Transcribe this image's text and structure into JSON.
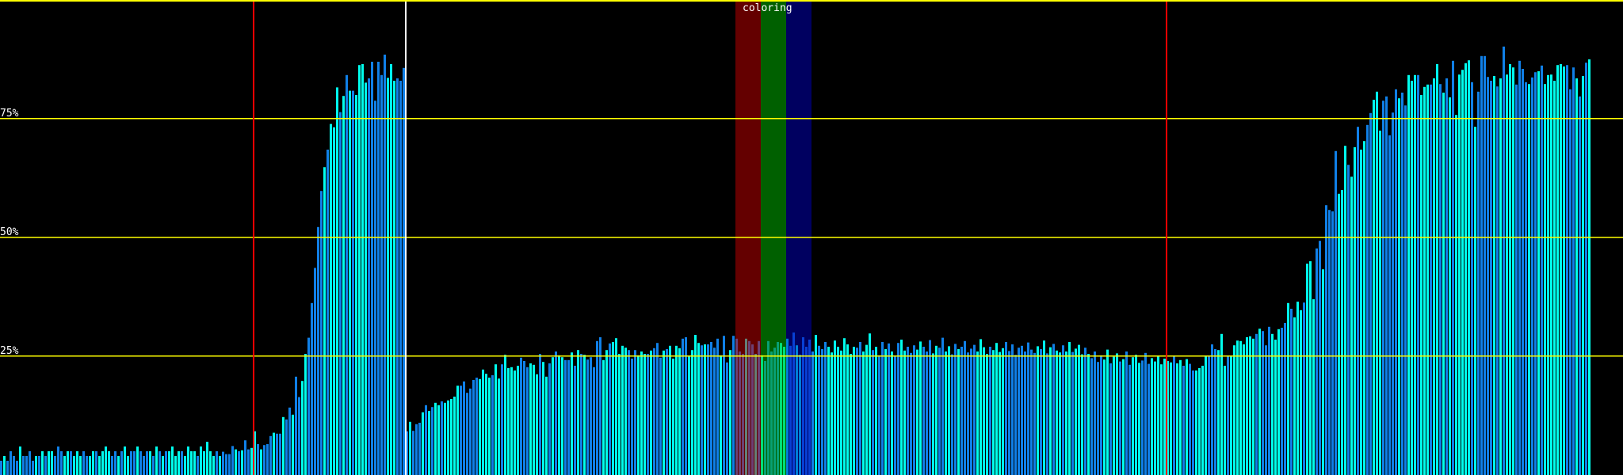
{
  "chart_data": {
    "type": "bar",
    "title": "",
    "xlabel": "",
    "ylabel": "",
    "ylim": [
      0,
      100
    ],
    "y_unit": "%",
    "grid": true,
    "yticks": [
      {
        "value": 75,
        "label": "75%"
      },
      {
        "value": 50,
        "label": "50%"
      },
      {
        "value": 25,
        "label": "25%"
      }
    ],
    "annotation": "coloring",
    "colors": {
      "bar_a": "#00ffee",
      "bar_b": "#1080e8",
      "gridline": "#ffff00",
      "marker_red": "#ff0000",
      "marker_white": "#ffffff",
      "band_red": "#c80000",
      "band_green": "#00c000",
      "band_blue": "#0000c0"
    },
    "values": [
      3,
      4,
      3,
      5,
      4,
      3,
      6,
      4,
      4,
      5,
      3,
      4,
      4,
      5,
      4,
      5,
      5,
      4,
      6,
      5,
      4,
      5,
      5,
      4,
      5,
      4,
      5,
      4,
      4,
      5,
      5,
      4,
      5,
      6,
      5,
      4,
      5,
      4,
      5,
      6,
      4,
      5,
      5,
      6,
      5,
      4,
      5,
      5,
      4,
      6,
      5,
      4,
      5,
      5,
      6,
      4,
      5,
      5,
      4,
      6,
      5,
      5,
      4,
      6,
      5,
      7,
      5,
      4,
      5,
      4,
      4.9,
      4.4,
      4.4,
      6.1,
      5.4,
      5.0,
      5.2,
      7.3,
      5.4,
      5.7,
      9.2,
      6.5,
      5.4,
      6.3,
      6.5,
      8.2,
      8.9,
      8.7,
      8.7,
      12.2,
      11.7,
      14.2,
      12.7,
      20.7,
      16.4,
      19.8,
      25.5,
      28.9,
      36.2,
      43.6,
      52.2,
      59.8,
      64.8,
      68.5,
      73.9,
      73.2,
      81.6,
      76.4,
      79.8,
      84.2,
      80.9,
      80.9,
      80.0,
      86.3,
      86.5,
      82.6,
      83.5,
      87.0,
      78.8,
      87.0,
      84.2,
      88.5,
      83.6,
      86.5,
      83.0,
      83.5,
      83.0,
      85.7,
      9.2,
      11.2,
      9.3,
      10.7,
      11.0,
      13.2,
      14.7,
      13.5,
      14.3,
      15.2,
      14.7,
      15.5,
      15.2,
      15.7,
      16.0,
      16.5,
      18.8,
      18.8,
      19.7,
      17.3,
      18.2,
      20,
      20.5,
      20.2,
      22.2,
      21.3,
      20.5,
      21,
      23.3,
      20.3,
      23.3,
      25.3,
      22.5,
      22.7,
      22,
      23,
      24.7,
      24,
      22.7,
      23.5,
      23.2,
      21.2,
      25.5,
      23.8,
      20.7,
      23.5,
      24.8,
      26,
      25.2,
      24.8,
      24.2,
      24.2,
      25.8,
      23,
      26.3,
      25.5,
      25.3,
      24.3,
      24.8,
      22.7,
      28.2,
      29,
      24.2,
      26.3,
      27.7,
      28,
      28.8,
      25.5,
      27.2,
      26.8,
      26.3,
      24.5,
      26.3,
      25.2,
      26,
      25.5,
      25.5,
      26.2,
      26.7,
      27.8,
      24.7,
      26.2,
      26.5,
      27.2,
      24.5,
      27.2,
      26.7,
      28.7,
      29,
      25,
      26.3,
      29.5,
      27.8,
      27.3,
      27.5,
      27.5,
      28,
      26.8,
      28.7,
      25.2,
      29.3,
      23.7,
      26.3,
      29.3,
      28.7,
      26,
      25.5,
      28.7,
      28.2,
      27.5,
      25.5,
      28.2,
      25.2,
      24,
      28.2,
      26,
      26.8,
      28,
      27.8,
      27,
      28.7,
      27.2,
      30,
      27.3,
      25.3,
      29,
      27,
      28.5,
      26,
      29.5,
      27.2,
      26.5,
      28,
      27,
      25.8,
      28.3,
      27,
      26.2,
      28.8,
      27.5,
      25.5,
      27,
      26.8,
      28,
      26,
      27.4,
      29.8,
      26.3,
      27,
      25.2,
      28,
      26.5,
      27.7,
      26,
      25,
      27.8,
      28.5,
      26.2,
      27,
      25.7,
      27.3,
      26.4,
      28.1,
      27,
      26,
      28.4,
      25.6,
      27.2,
      26.8,
      28.9,
      26,
      27.1,
      25.4,
      27.6,
      26.5,
      27,
      28.2,
      25.8,
      26.6,
      27.4,
      26,
      28.6,
      26.9,
      25.5,
      27,
      26.3,
      27.8,
      25.9,
      26.7,
      28,
      26.1,
      27.5,
      25.3,
      26.8,
      27.2,
      26,
      27.9,
      26.4,
      25.7,
      27.1,
      26.5,
      28.3,
      25.6,
      26.9,
      27.6,
      26.2,
      25.8,
      27.3,
      26,
      28,
      25.9,
      26.6,
      27.4,
      25.4,
      26.8,
      25.5,
      24.6,
      26,
      23.8,
      25.2,
      24.3,
      26.4,
      23.5,
      24.9,
      25.6,
      23.9,
      24.4,
      26,
      23.2,
      24.8,
      25.3,
      23.6,
      24.1,
      25.7,
      23.4,
      24.6,
      23.9,
      25.1,
      23.3,
      24.5,
      24,
      23.7,
      25,
      23.5,
      24.2,
      23,
      24.4,
      23.4,
      22,
      22,
      22.5,
      23,
      25,
      25,
      27.5,
      26.5,
      26.3,
      29.7,
      23,
      25,
      25,
      27.3,
      28.3,
      28.2,
      27.5,
      29,
      29.2,
      28.7,
      29.7,
      30.8,
      30.3,
      27.3,
      31.2,
      29.7,
      28.5,
      30.7,
      31,
      32,
      36.2,
      35,
      33.2,
      36.5,
      34.7,
      36.3,
      44.5,
      45,
      37,
      47.7,
      49.3,
      43.3,
      56.8,
      55.8,
      55.5,
      68.2,
      59.2,
      60,
      69.3,
      65.3,
      62.8,
      69,
      73.3,
      68.5,
      70.3,
      73.7,
      76.2,
      79,
      80.7,
      72.5,
      78.8,
      79.7,
      71.5,
      76.3,
      81.2,
      79.3,
      80.5,
      77.8,
      84.2,
      83,
      84.2,
      84.2,
      80,
      81.7,
      82.2,
      82.2,
      83.5,
      86.5,
      82.3,
      80.5,
      83.5,
      79.5,
      87.2,
      75.8,
      84.3,
      85.3,
      86.7,
      87.3,
      82.7,
      73.3,
      80.7,
      88.2,
      88.2,
      83.8,
      83,
      84,
      81.8,
      83.5,
      90.2,
      84.3,
      86.5,
      85.8,
      82.2,
      87.2,
      85.5,
      82.7,
      82.3,
      83.7,
      84.8,
      85,
      86.2,
      82.3,
      84.2,
      84.3,
      83,
      86.3,
      86.5,
      86,
      86.3,
      81.2,
      85.8,
      83.5,
      79.7,
      84,
      86.8,
      87.5
    ]
  }
}
